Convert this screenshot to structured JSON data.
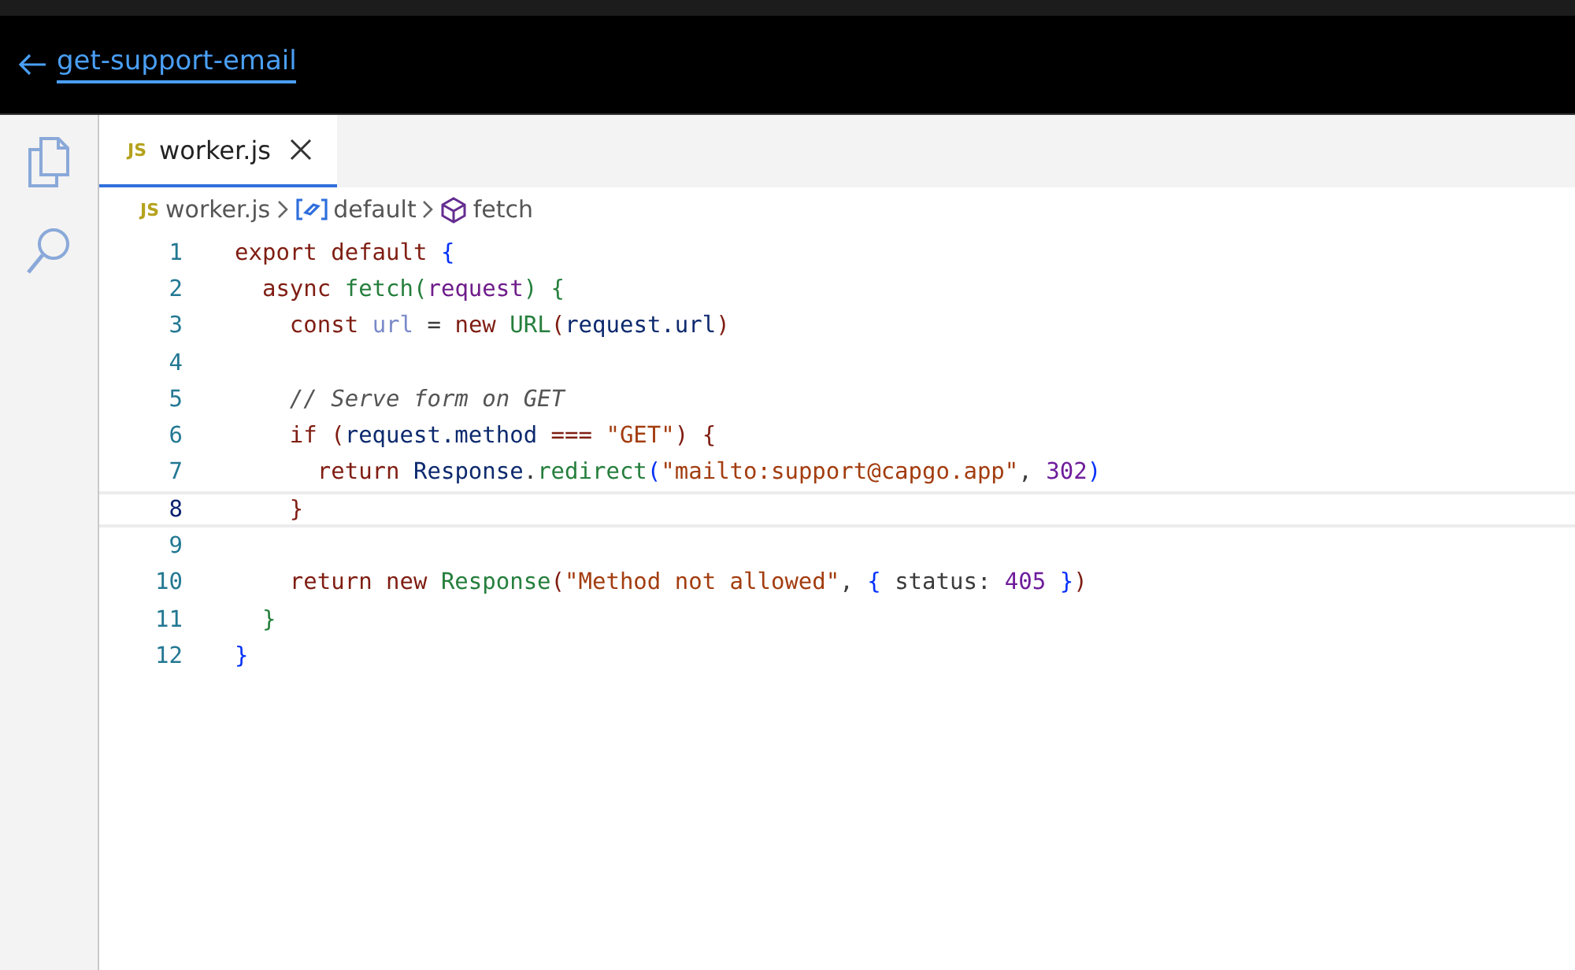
{
  "header": {
    "back_link": "get-support-email"
  },
  "tabs": [
    {
      "label": "worker.js",
      "badge": "JS",
      "selected": true
    }
  ],
  "breadcrumb": {
    "file_badge": "JS",
    "file": "worker.js",
    "items": [
      {
        "kind": "object",
        "label": "default"
      },
      {
        "kind": "method",
        "label": "fetch"
      }
    ]
  },
  "code": [
    {
      "number": "1",
      "selected": false,
      "tokens": [
        {
          "kind": "keyword",
          "text": "export default "
        },
        {
          "kind": "brace",
          "text": "{"
        }
      ]
    },
    {
      "number": "2",
      "selected": false,
      "tokens": [
        {
          "kind": "keyword",
          "text": "  async "
        },
        {
          "kind": "function",
          "text": "fetch("
        },
        {
          "kind": "param",
          "text": "request"
        },
        {
          "kind": "function",
          "text": ") {"
        }
      ]
    },
    {
      "number": "3",
      "selected": false,
      "tokens": [
        {
          "kind": "keyword",
          "text": "    const "
        },
        {
          "kind": "local",
          "text": "url"
        },
        {
          "kind": "plain",
          "text": " = "
        },
        {
          "kind": "keyword",
          "text": "new "
        },
        {
          "kind": "function",
          "text": "URL"
        },
        {
          "kind": "keyword",
          "text": "("
        },
        {
          "kind": "identifier",
          "text": "request.url"
        },
        {
          "kind": "keyword",
          "text": ")"
        }
      ]
    },
    {
      "number": "4",
      "selected": false
    },
    {
      "number": "5",
      "selected": false,
      "tokens": [
        {
          "kind": "comment",
          "text": "    // Serve form on GET"
        }
      ]
    },
    {
      "number": "6",
      "selected": false,
      "tokens": [
        {
          "kind": "keyword",
          "text": "    if ("
        },
        {
          "kind": "identifier",
          "text": "request.method"
        },
        {
          "kind": "keyword",
          "text": " === "
        },
        {
          "kind": "string",
          "text": "\"GET\""
        },
        {
          "kind": "keyword",
          "text": ") {"
        }
      ]
    },
    {
      "number": "7",
      "selected": false,
      "tokens": [
        {
          "kind": "keyword",
          "text": "      return "
        },
        {
          "kind": "identifier",
          "text": "Response"
        },
        {
          "kind": "plain",
          "text": "."
        },
        {
          "kind": "function",
          "text": "redirect"
        },
        {
          "kind": "brace",
          "text": "("
        },
        {
          "kind": "string",
          "text": "\"mailto:support@capgo.app\""
        },
        {
          "kind": "plain",
          "text": ", "
        },
        {
          "kind": "number",
          "text": "302"
        },
        {
          "kind": "brace",
          "text": ")"
        }
      ]
    },
    {
      "number": "8",
      "selected": true,
      "tokens": [
        {
          "kind": "keyword",
          "text": "    }"
        }
      ]
    },
    {
      "number": "9",
      "selected": false
    },
    {
      "number": "10",
      "selected": false,
      "tokens": [
        {
          "kind": "keyword",
          "text": "    return new "
        },
        {
          "kind": "function",
          "text": "Response"
        },
        {
          "kind": "keyword",
          "text": "("
        },
        {
          "kind": "string",
          "text": "\"Method not allowed\""
        },
        {
          "kind": "plain",
          "text": ", "
        },
        {
          "kind": "brace",
          "text": "{"
        },
        {
          "kind": "plain",
          "text": " status: "
        },
        {
          "kind": "number",
          "text": "405"
        },
        {
          "kind": "brace",
          "text": " }"
        },
        {
          "kind": "keyword",
          "text": ")"
        }
      ]
    },
    {
      "number": "11",
      "selected": false,
      "tokens": [
        {
          "kind": "function",
          "text": "  }"
        }
      ]
    },
    {
      "number": "12",
      "selected": false,
      "tokens": [
        {
          "kind": "brace",
          "text": "}"
        }
      ]
    }
  ]
}
